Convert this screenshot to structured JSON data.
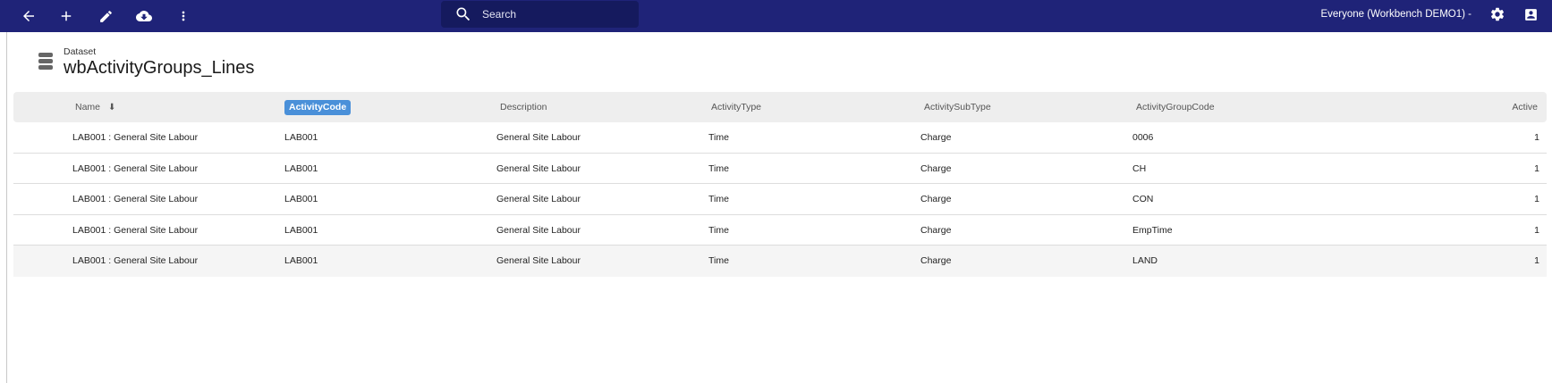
{
  "toolbar": {
    "icons": [
      "back-arrow-icon",
      "add-icon",
      "edit-pencil-icon",
      "cloud-download-icon",
      "more-vert-icon"
    ],
    "search_placeholder": "Search",
    "tenant_label": "Everyone (Workbench DEMO1) -",
    "right_icons": [
      "settings-gear-icon",
      "account-box-icon"
    ],
    "bar_color": "#1f2378"
  },
  "dataset": {
    "label": "Dataset",
    "title": "wbActivityGroups_Lines",
    "icon": "database-icon"
  },
  "table": {
    "columns": [
      "Name",
      "ActivityCode",
      "Description",
      "ActivityType",
      "ActivitySubType",
      "ActivityGroupCode",
      "Active"
    ],
    "sorted_column": "Name",
    "highlighted_column": "ActivityCode",
    "highlight_color": "#4a90d9",
    "rows": [
      [
        "LAB001 : General Site Labour",
        "LAB001",
        "General Site Labour",
        "Time",
        "Charge",
        "0006",
        "1"
      ],
      [
        "LAB001 : General Site Labour",
        "LAB001",
        "General Site Labour",
        "Time",
        "Charge",
        "CH",
        "1"
      ],
      [
        "LAB001 : General Site Labour",
        "LAB001",
        "General Site Labour",
        "Time",
        "Charge",
        "CON",
        "1"
      ],
      [
        "LAB001 : General Site Labour",
        "LAB001",
        "General Site Labour",
        "Time",
        "Charge",
        "EmpTime",
        "1"
      ],
      [
        "LAB001 : General Site Labour",
        "LAB001",
        "General Site Labour",
        "Time",
        "Charge",
        "LAND",
        "1"
      ]
    ]
  }
}
